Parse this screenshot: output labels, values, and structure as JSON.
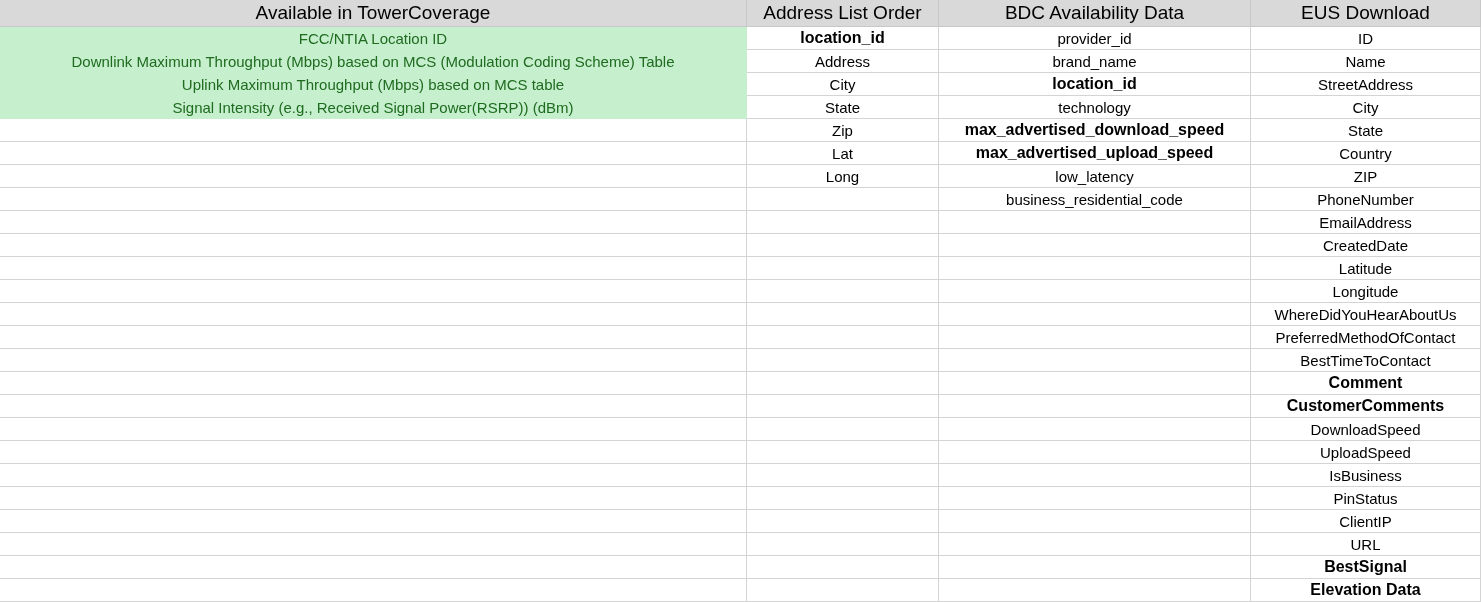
{
  "table": {
    "columns": [
      {
        "header": "Available in TowerCoverage",
        "cells": [
          {
            "text": "FCC/NTIA Location ID",
            "bold": false,
            "highlighted": true
          },
          {
            "text": "Downlink Maximum Throughput (Mbps) based on MCS (Modulation Coding Scheme) Table",
            "bold": false,
            "highlighted": true
          },
          {
            "text": "Uplink Maximum Throughput (Mbps) based on MCS table",
            "bold": false,
            "highlighted": true
          },
          {
            "text": "Signal Intensity (e.g., Received Signal Power(RSRP)) (dBm)",
            "bold": false,
            "highlighted": true
          }
        ]
      },
      {
        "header": "Address List Order",
        "cells": [
          {
            "text": "location_id",
            "bold": true,
            "highlighted": false
          },
          {
            "text": "Address",
            "bold": false,
            "highlighted": false
          },
          {
            "text": "City",
            "bold": false,
            "highlighted": false
          },
          {
            "text": "State",
            "bold": false,
            "highlighted": false
          },
          {
            "text": "Zip",
            "bold": false,
            "highlighted": false
          },
          {
            "text": "Lat",
            "bold": false,
            "highlighted": false
          },
          {
            "text": "Long",
            "bold": false,
            "highlighted": false
          }
        ]
      },
      {
        "header": "BDC Availability Data",
        "cells": [
          {
            "text": "provider_id",
            "bold": false,
            "highlighted": false
          },
          {
            "text": "brand_name",
            "bold": false,
            "highlighted": false
          },
          {
            "text": "location_id",
            "bold": true,
            "highlighted": false
          },
          {
            "text": "technology",
            "bold": false,
            "highlighted": false
          },
          {
            "text": "max_advertised_download_speed",
            "bold": true,
            "highlighted": false
          },
          {
            "text": "max_advertised_upload_speed",
            "bold": true,
            "highlighted": false
          },
          {
            "text": "low_latency",
            "bold": false,
            "highlighted": false
          },
          {
            "text": "business_residential_code",
            "bold": false,
            "highlighted": false
          }
        ]
      },
      {
        "header": "EUS Download",
        "cells": [
          {
            "text": "ID",
            "bold": false,
            "highlighted": false
          },
          {
            "text": "Name",
            "bold": false,
            "highlighted": false
          },
          {
            "text": "StreetAddress",
            "bold": false,
            "highlighted": false
          },
          {
            "text": "City",
            "bold": false,
            "highlighted": false
          },
          {
            "text": "State",
            "bold": false,
            "highlighted": false
          },
          {
            "text": "Country",
            "bold": false,
            "highlighted": false
          },
          {
            "text": "ZIP",
            "bold": false,
            "highlighted": false
          },
          {
            "text": "PhoneNumber",
            "bold": false,
            "highlighted": false
          },
          {
            "text": "EmailAddress",
            "bold": false,
            "highlighted": false
          },
          {
            "text": "CreatedDate",
            "bold": false,
            "highlighted": false
          },
          {
            "text": "Latitude",
            "bold": false,
            "highlighted": false
          },
          {
            "text": "Longitude",
            "bold": false,
            "highlighted": false
          },
          {
            "text": "WhereDidYouHearAboutUs",
            "bold": false,
            "highlighted": false
          },
          {
            "text": "PreferredMethodOfContact",
            "bold": false,
            "highlighted": false
          },
          {
            "text": "BestTimeToContact",
            "bold": false,
            "highlighted": false
          },
          {
            "text": "Comment",
            "bold": true,
            "highlighted": false
          },
          {
            "text": "CustomerComments",
            "bold": true,
            "highlighted": false
          },
          {
            "text": "DownloadSpeed",
            "bold": false,
            "highlighted": false
          },
          {
            "text": "UploadSpeed",
            "bold": false,
            "highlighted": false
          },
          {
            "text": "IsBusiness",
            "bold": false,
            "highlighted": false
          },
          {
            "text": "PinStatus",
            "bold": false,
            "highlighted": false
          },
          {
            "text": "ClientIP",
            "bold": false,
            "highlighted": false
          },
          {
            "text": "URL",
            "bold": false,
            "highlighted": false
          },
          {
            "text": "BestSignal",
            "bold": true,
            "highlighted": false
          },
          {
            "text": "Elevation Data",
            "bold": true,
            "highlighted": false
          }
        ]
      }
    ]
  }
}
